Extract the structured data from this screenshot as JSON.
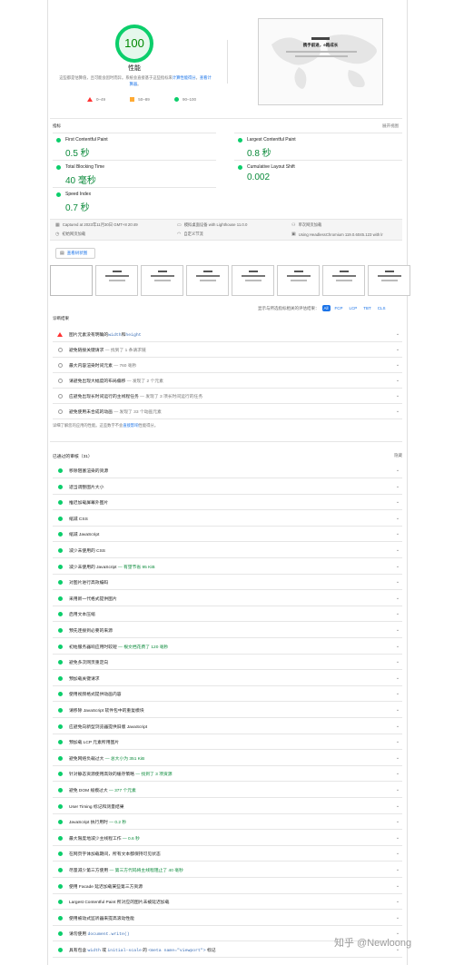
{
  "score": {
    "value": "100",
    "title": "性能",
    "desc_pre": "这些都是估算值，且可能会因时而异。系统会直接基于这些指标来",
    "desc_link1": "计算性能得分",
    "desc_mid": "。",
    "desc_link2": "查看计算器",
    "desc_post": "。",
    "legend": [
      "0–49",
      "50–89",
      "90–100"
    ],
    "colors": {
      "pass": "#0cce6b",
      "average": "#ffaa33",
      "fail": "#ff3333"
    }
  },
  "screenshot": {
    "title": "携手前进，e路成长"
  },
  "metrics": {
    "label": "指标",
    "expand_label": "展开视图",
    "items": [
      {
        "name": "First Contentful Paint",
        "value": "0.5 秒"
      },
      {
        "name": "Largest Contentful Paint",
        "value": "0.8 秒"
      },
      {
        "name": "Total Blocking Time",
        "value": "40 毫秒"
      },
      {
        "name": "Cumulative Layout Shift",
        "value": "0.002"
      },
      {
        "name": "Speed Index",
        "value": "0.7 秒"
      }
    ]
  },
  "environment": [
    {
      "icon": "calendar-icon",
      "text": "Captured at 2023年11月30日 GMT+8 20:49"
    },
    {
      "icon": "laptop-icon",
      "text": "模拟桌面设备 with Lighthouse 11.0.0"
    },
    {
      "icon": "people-icon",
      "text": "单次网页加载"
    },
    {
      "icon": "timer-icon",
      "text": "初始网页加载"
    },
    {
      "icon": "wifi-icon",
      "text": "自定义节流"
    },
    {
      "icon": "browser-icon",
      "text": "Using HeadlessChromium 119.0.6045.123 with lr"
    }
  ],
  "treemap_label": "查看树状图",
  "filter": {
    "label": "显示与所选指标相关的评估结果：",
    "chips": [
      "All",
      "FCP",
      "LCP",
      "TBT",
      "CLS"
    ]
  },
  "diagnostics": {
    "label": "诊断结果",
    "items": [
      {
        "status": "fail",
        "text": "图片元素没有明确的",
        "code1": "width",
        "and": "和",
        "code2": "height",
        "sub": ""
      },
      {
        "status": "info",
        "text": "避免链接关键请求",
        "sub": " — 找到了 1 条请求链"
      },
      {
        "status": "info",
        "text": "最大内容渲染时间元素",
        "sub": " — 760 毫秒"
      },
      {
        "status": "info",
        "text": "请避免出现大幅度的布局偏移",
        "sub": " — 发现了 2 个元素"
      },
      {
        "status": "info",
        "text": "应避免出现长时间运行的主线程任务",
        "sub": " — 发现了 3 项长时间运行的任务"
      },
      {
        "status": "info",
        "text": "避免使用未合成的动画",
        "sub": " — 发现了 33 个动画元素"
      }
    ],
    "note_pre": "详细了解您的应用的性能。这些数字不会",
    "note_link": "直接影响",
    "note_post": "性能得分。"
  },
  "passed": {
    "label": "已通过的审核（31）",
    "hide_label": "隐藏",
    "items": [
      {
        "text": "移除阻塞渲染的资源",
        "sub": ""
      },
      {
        "text": "适当调整图片大小",
        "sub": ""
      },
      {
        "text": "推迟加载屏幕外图片",
        "sub": ""
      },
      {
        "text": "缩减 CSS",
        "sub": ""
      },
      {
        "text": "缩减 JavaScript",
        "sub": ""
      },
      {
        "text": "减少未使用的 CSS",
        "sub": ""
      },
      {
        "text": "减少未使用的 JavaScript",
        "sub": " — 有望节省 95 KiB"
      },
      {
        "text": "对图片进行高效编码",
        "sub": ""
      },
      {
        "text": "采用新一代格式提供图片",
        "sub": ""
      },
      {
        "text": "启用文本压缩",
        "sub": ""
      },
      {
        "text": "预先连接到必要的来源",
        "sub": ""
      },
      {
        "text": "初始服务器响应用时较短",
        "sub": " — 根文档花费了 120 毫秒"
      },
      {
        "text": "避免多次网页重定向",
        "sub": ""
      },
      {
        "text": "预加载关键请求",
        "sub": ""
      },
      {
        "text": "使用视频格式提供动画内容",
        "sub": ""
      },
      {
        "text": "请移除 JavaScript 软件包中的重复模块",
        "sub": ""
      },
      {
        "text": "应避免向新型浏览器提供旧版 JavaScript",
        "sub": ""
      },
      {
        "text": "预加载 LCP 元素所用图片",
        "sub": ""
      },
      {
        "text": "避免网络负载过大",
        "sub": " — 总大小为 351 KiB"
      },
      {
        "text": "针对静态资源使用高效的缓存策略",
        "sub": " — 找到了 3 项资源"
      },
      {
        "text": "避免 DOM 规模过大",
        "sub": " — 377 个元素"
      },
      {
        "text": "User Timing 标记和测量结果",
        "sub": ""
      },
      {
        "text": "JavaScript 执行用时",
        "sub": " — 0.2 秒"
      },
      {
        "text": "最大限度地减少主线程工作",
        "sub": " — 0.6 秒"
      },
      {
        "text": "在网页字体加载期间，所有文本都保持可见状态",
        "sub": ""
      },
      {
        "text": "尽量减少第三方使用",
        "sub": " — 第三方代码将主线程阻止了 40 毫秒"
      },
      {
        "text": "使用 Facade 延迟加载某些第三方资源",
        "sub": ""
      },
      {
        "text": "Largest Contentful Paint 所对应的图片未被延迟加载",
        "sub": ""
      },
      {
        "text": "使用被动式监听器来提高滚动性能",
        "sub": ""
      }
    ],
    "item_code": {
      "pre": "请勿使用 ",
      "code": "document.write()"
    },
    "item_viewport": {
      "pre": "具有包含 ",
      "code1": "width",
      "mid": " 或 ",
      "code2": "initial-scale",
      "mid2": " 的 ",
      "code3": "<meta name=\"viewport\">",
      "post": " 标记"
    }
  },
  "watermark": "知乎 @Newloong"
}
